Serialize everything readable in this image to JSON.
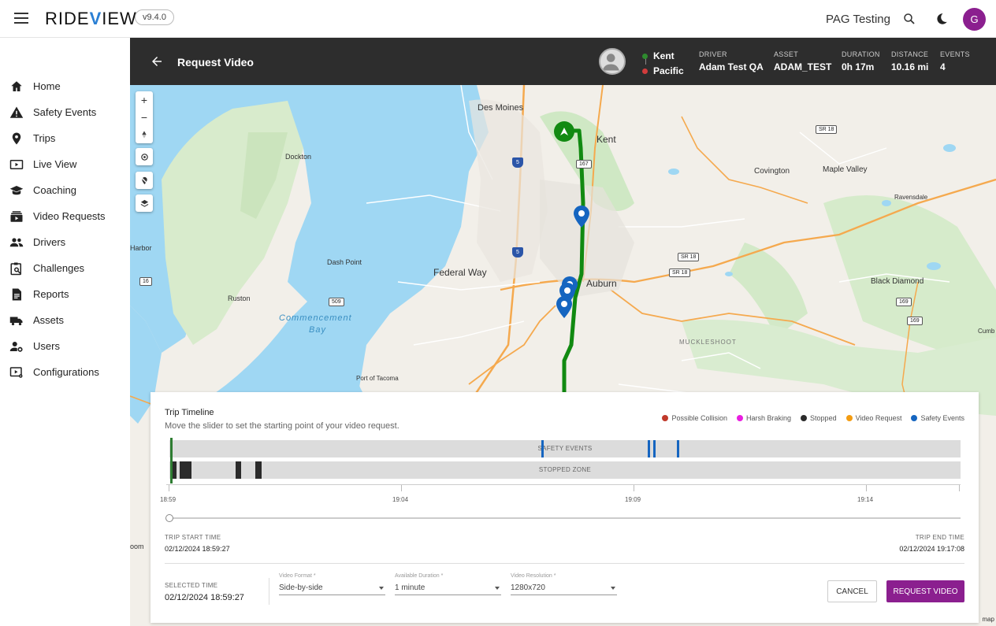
{
  "header": {
    "logo_prefix": "RIDE",
    "logo_v": "V",
    "logo_suffix": "IEW",
    "version": "v9.4.0",
    "org": "PAG Testing",
    "avatar_initial": "G",
    "avatar_color": "#8b1f8f"
  },
  "sidebar": {
    "items": [
      {
        "label": "Home",
        "icon": "home-icon"
      },
      {
        "label": "Safety Events",
        "icon": "warning-icon"
      },
      {
        "label": "Trips",
        "icon": "location-pin-icon"
      },
      {
        "label": "Live View",
        "icon": "live-tv-icon"
      },
      {
        "label": "Coaching",
        "icon": "graduation-cap-icon"
      },
      {
        "label": "Video Requests",
        "icon": "video-stack-icon"
      },
      {
        "label": "Drivers",
        "icon": "people-icon"
      },
      {
        "label": "Challenges",
        "icon": "clipboard-search-icon"
      },
      {
        "label": "Reports",
        "icon": "document-icon"
      },
      {
        "label": "Assets",
        "icon": "truck-icon"
      },
      {
        "label": "Users",
        "icon": "user-gear-icon"
      },
      {
        "label": "Configurations",
        "icon": "video-settings-icon"
      }
    ]
  },
  "trip_header": {
    "title": "Request Video",
    "origin": "Kent",
    "destination": "Pacific",
    "origin_color": "#2e8b2e",
    "destination_color": "#d23c3c",
    "driver_label": "DRIVER",
    "driver": "Adam Test QA",
    "asset_label": "ASSET",
    "asset": "ADAM_TEST",
    "duration_label": "DURATION",
    "duration": "0h 17m",
    "distance_label": "DISTANCE",
    "distance": "10.16 mi",
    "events_label": "EVENTS",
    "events": "4"
  },
  "map": {
    "labels": {
      "des_moines": "Des Moines",
      "kent": "Kent",
      "dockton": "Dockton",
      "covington": "Covington",
      "maple_valley": "Maple Valley",
      "ravensdale": "Ravensdale",
      "harbor": "Harbor",
      "dash_point": "Dash Point",
      "federal_way": "Federal Way",
      "auburn": "Auburn",
      "black_diamond": "Black Diamond",
      "ruston": "Ruston",
      "commencement_1": "Commencement",
      "commencement_2": "Bay",
      "muckleshoot": "MUCKLESHOOT",
      "port_of_tacoma": "Port of Tacoma",
      "cumb": "Cumb",
      "oom": "oom",
      "attribution": "map"
    },
    "shields": {
      "sr18_a": "SR 18",
      "sr18_b": "SR 18",
      "sr18_c": "SR 18",
      "r167": "167",
      "r509": "509",
      "r16": "16",
      "r169_a": "169",
      "r169_b": "169",
      "i5_a": "5",
      "i5_b": "5"
    },
    "route_color": "#118a11",
    "marker_color": "#1565c0"
  },
  "timeline": {
    "title": "Trip Timeline",
    "subtitle": "Move the slider to set the starting point of your video request.",
    "legend": [
      {
        "label": "Possible Collision",
        "color": "#c0392b"
      },
      {
        "label": "Harsh Braking",
        "color": "#e91ee0"
      },
      {
        "label": "Stopped",
        "color": "#2b2b2b"
      },
      {
        "label": "Video Request",
        "color": "#f39c12"
      },
      {
        "label": "Safety Events",
        "color": "#1565c0"
      }
    ],
    "safety_track_label": "SAFETY EVENTS",
    "stopped_track_label": "STOPPED ZONE",
    "ticks": [
      "18:59",
      "19:04",
      "19:09",
      "19:14"
    ],
    "start_label": "TRIP START TIME",
    "start_value": "02/12/2024 18:59:27",
    "end_label": "TRIP END TIME",
    "end_value": "02/12/2024 19:17:08",
    "selected_label": "SELECTED TIME",
    "selected_value": "02/12/2024 18:59:27",
    "slider_fraction": 0,
    "video_format_label": "Video Format *",
    "video_format_value": "Side-by-side",
    "duration_label": "Available Duration *",
    "duration_value": "1 minute",
    "resolution_label": "Video Resolution *",
    "resolution_value": "1280x720",
    "cancel_label": "CANCEL",
    "request_label": "REQUEST VIDEO",
    "request_color": "#8b1f8f"
  }
}
